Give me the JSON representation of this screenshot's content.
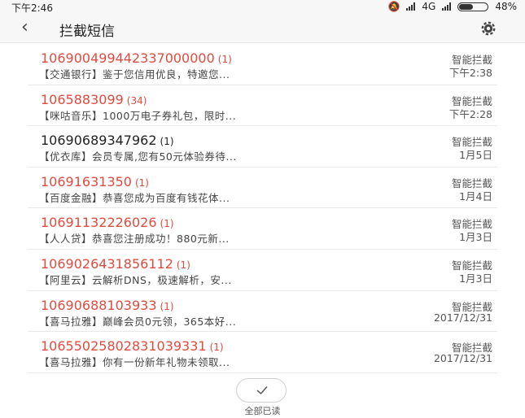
{
  "status": {
    "time": "下午2:46",
    "network": "4G",
    "battery": "48%",
    "battery_level": 0.48
  },
  "header": {
    "title": "拦截短信",
    "back_icon": "chevron-left-icon",
    "settings_icon": "gear-icon"
  },
  "messages": [
    {
      "sender": "106900499442337000000",
      "count": "(1)",
      "preview": "【交通银行】鉴于您信用优良，特邀您...",
      "tag": "智能拦截",
      "time": "下午2:38",
      "unread": true
    },
    {
      "sender": "1065883099",
      "count": "(34)",
      "preview": "【咪咕音乐】1000万电子券礼包，限时...",
      "tag": "智能拦截",
      "time": "下午2:28",
      "unread": true
    },
    {
      "sender": "10690689347962",
      "count": "(1)",
      "preview": "【优衣库】会员专属,您有50元体验券待...",
      "tag": "智能拦截",
      "time": "1月5日",
      "unread": false
    },
    {
      "sender": "10691631350",
      "count": "(1)",
      "preview": "【百度金融】恭喜您成为百度有钱花体...",
      "tag": "智能拦截",
      "time": "1月4日",
      "unread": true
    },
    {
      "sender": "10691132226026",
      "count": "(1)",
      "preview": "【人人贷】恭喜您注册成功！880元新...",
      "tag": "智能拦截",
      "time": "1月3日",
      "unread": true
    },
    {
      "sender": "1069026431856112",
      "count": "(1)",
      "preview": "【阿里云】云解析DNS，极速解析，安...",
      "tag": "智能拦截",
      "time": "1月3日",
      "unread": true
    },
    {
      "sender": "10690688103933",
      "count": "(1)",
      "preview": "【喜马拉雅】巅峰会员0元领，365本好...",
      "tag": "智能拦截",
      "time": "2017/12/31",
      "unread": true
    },
    {
      "sender": "10655025802831039331",
      "count": "(1)",
      "preview": "【喜马拉雅】你有一份新年礼物未领取...",
      "tag": "智能拦截",
      "time": "2017/12/31",
      "unread": true
    }
  ],
  "footer": {
    "read_all_label": "全部已读",
    "check_icon": "check-icon"
  },
  "colors": {
    "unread_sender": "#e04b3f",
    "read_sender": "#222222",
    "divider": "#e9e9e9"
  }
}
